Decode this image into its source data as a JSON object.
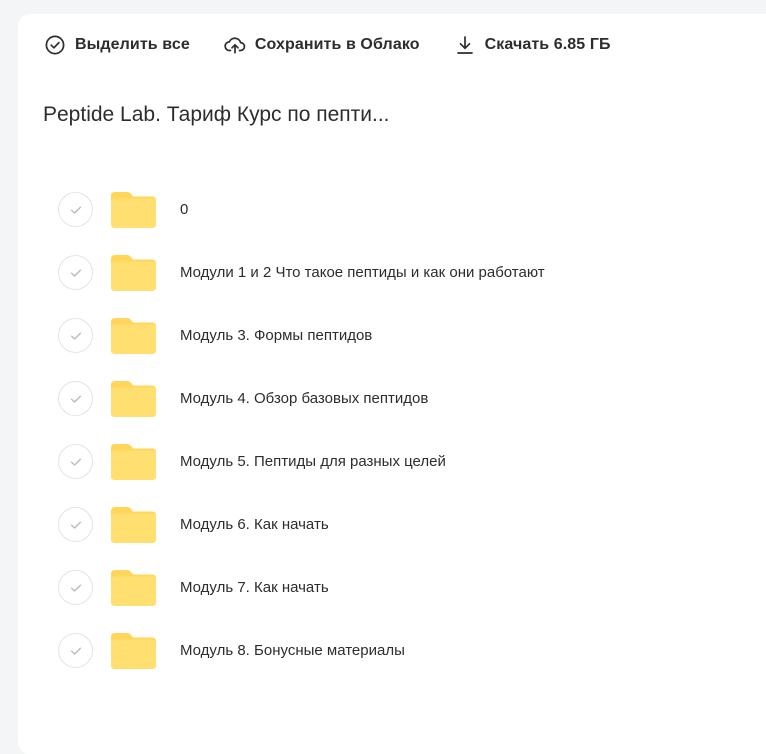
{
  "toolbar": {
    "select_all": {
      "label": "Выделить все",
      "icon": "check-circle-icon"
    },
    "save_cloud": {
      "label": "Сохранить в Облако",
      "icon": "cloud-upload-icon"
    },
    "download": {
      "label": "Скачать 6.85 ГБ",
      "icon": "download-icon"
    }
  },
  "title": "Peptide Lab. Тариф Курс по пепти...",
  "colors": {
    "folder": "#ffdf70",
    "folder_back": "#ffd659",
    "text": "#2c2d2e",
    "check": "#b9bbbf"
  },
  "items": [
    {
      "name": "0",
      "icon": "folder-icon"
    },
    {
      "name": "Модули 1 и 2 Что такое пептиды и как они работают",
      "icon": "folder-icon"
    },
    {
      "name": "Модуль 3. Формы пептидов",
      "icon": "folder-icon"
    },
    {
      "name": "Модуль 4. Обзор базовых пептидов",
      "icon": "folder-icon"
    },
    {
      "name": "Модуль 5. Пептиды для разных целей",
      "icon": "folder-icon"
    },
    {
      "name": "Модуль 6. Как начать",
      "icon": "folder-icon"
    },
    {
      "name": "Модуль 7. Как начать",
      "icon": "folder-icon"
    },
    {
      "name": "Модуль 8. Бонусные материалы",
      "icon": "folder-icon"
    }
  ]
}
